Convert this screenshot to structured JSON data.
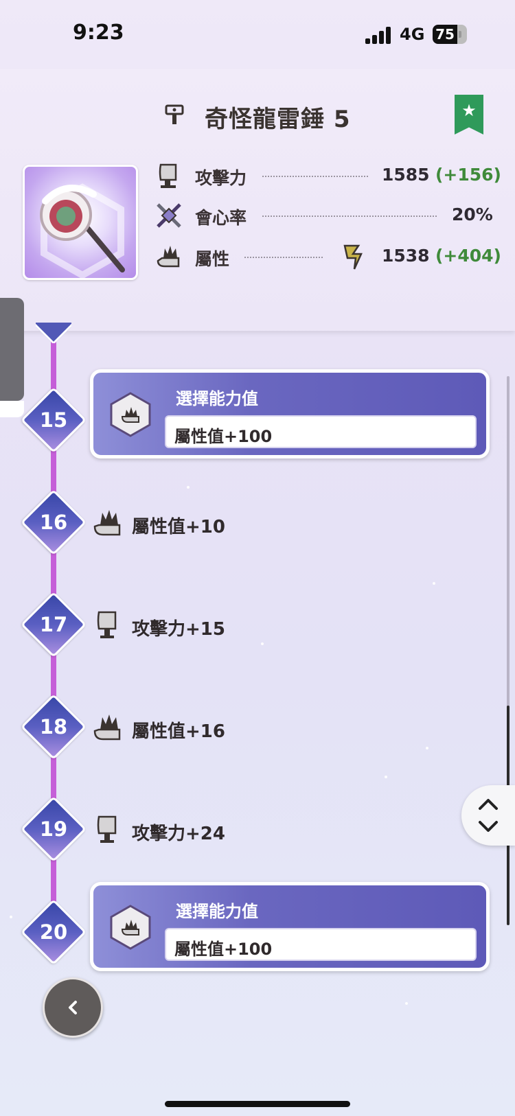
{
  "status_bar": {
    "time": "9:23",
    "network": "4G",
    "battery": "75"
  },
  "header": {
    "title": "奇怪龍雷錘 5",
    "stats": [
      {
        "label": "攻擊力",
        "value": "1585",
        "bonus": "(+156)",
        "icon": "attack-icon"
      },
      {
        "label": "會心率",
        "value": "20%",
        "bonus": "",
        "icon": "affinity-icon"
      },
      {
        "label": "屬性",
        "value": "1538",
        "bonus": "(+404)",
        "icon": "element-icon",
        "element_icon": "thunder-icon"
      }
    ]
  },
  "timeline": {
    "levels": [
      {
        "level": "15",
        "type": "card",
        "card_title": "選擇能力值",
        "card_value": "屬性值+100"
      },
      {
        "level": "16",
        "type": "item",
        "icon": "element-icon",
        "text": "屬性值+10"
      },
      {
        "level": "17",
        "type": "item",
        "icon": "attack-icon",
        "text": "攻擊力+15"
      },
      {
        "level": "18",
        "type": "item",
        "icon": "element-icon",
        "text": "屬性值+16"
      },
      {
        "level": "19",
        "type": "item",
        "icon": "attack-icon",
        "text": "攻擊力+24"
      },
      {
        "level": "20",
        "type": "card",
        "card_title": "選擇能力值",
        "card_value": "屬性值+100"
      }
    ]
  },
  "colors": {
    "accent": "#5e5ab8",
    "bonus": "#3f8a3a",
    "timeline": "#c55fd8",
    "bookmark": "#2f9a5a"
  }
}
